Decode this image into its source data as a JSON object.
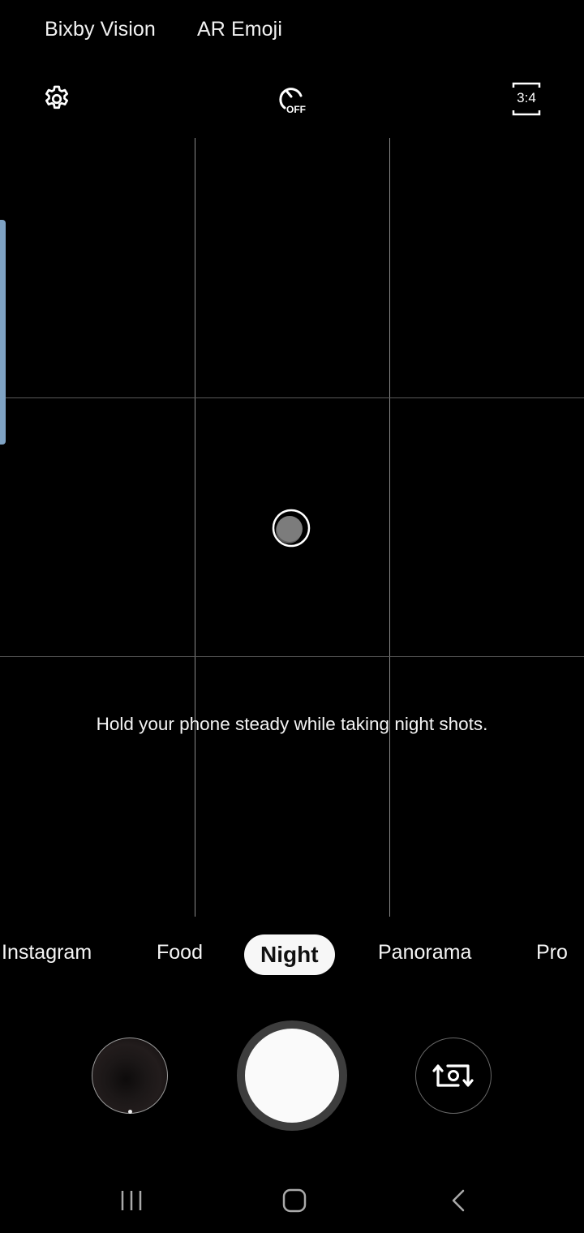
{
  "top_bar": {
    "modes": [
      {
        "label": "Bixby Vision"
      },
      {
        "label": "AR Emoji"
      }
    ],
    "settings_icon": "gear-icon",
    "timer": {
      "icon": "timer-icon",
      "state": "OFF"
    },
    "aspect_ratio": {
      "icon": "aspect-ratio-icon",
      "label": "3:4"
    }
  },
  "viewfinder": {
    "grid": "3x3",
    "hint": "Hold your phone steady while taking night shots.",
    "side_panel_color": "#7fa3c4"
  },
  "mode_selector": {
    "modes": [
      "Instagram",
      "Food",
      "Night",
      "Panorama",
      "Pro"
    ],
    "selected": "Night"
  },
  "controls": {
    "gallery_icon": "gallery-thumbnail",
    "shutter_icon": "shutter-button",
    "switch_camera_icon": "switch-camera-icon"
  },
  "nav_bar": {
    "recents_icon": "recents-icon",
    "home_icon": "home-icon",
    "back_icon": "back-icon"
  }
}
